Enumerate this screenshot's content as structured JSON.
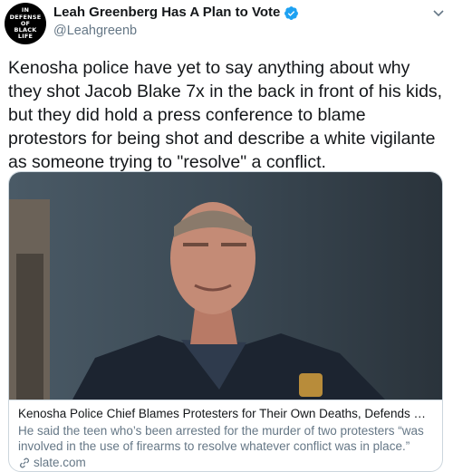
{
  "tweet": {
    "display_name": "Leah Greenberg Has A Plan to Vote",
    "handle": "@Leahgreenb",
    "avatar_lines": [
      "IN",
      "DEFENSE",
      "OF",
      "BLACK",
      "LIFE"
    ],
    "text": "Kenosha police have yet to say anything about why they shot Jacob Blake 7x in the back in front of his kids, but they did hold a press conference to blame protestors for being shot and describe a white vigilante as someone trying to \"resolve\" a conflict."
  },
  "card": {
    "title": "Kenosha Police Chief Blames Protesters for Their Own Deaths, Defends Vigila...",
    "description": "He said the teen who’s been arrested for the murder of two protesters “was involved in the use of firearms to resolve whatever conflict was in place.”",
    "domain": "slate.com"
  },
  "icons": {
    "verified": "verified-badge-icon",
    "menu": "chevron-down-icon",
    "link": "link-icon"
  },
  "colors": {
    "verified": "#1da1f2",
    "secondary_text": "#657786",
    "border": "#ccd6dd"
  }
}
